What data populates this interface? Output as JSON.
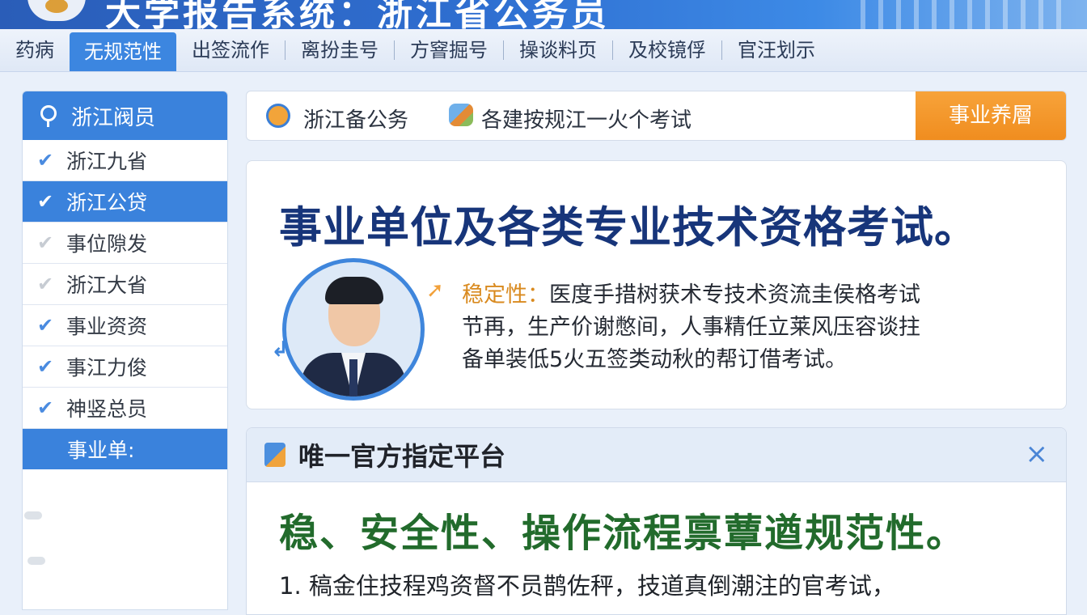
{
  "header": {
    "title": "大学报告系统：浙江省公务员"
  },
  "nav": {
    "items": [
      "药病",
      "无规范性",
      "出签流作",
      "离扮圭号",
      "方窨掘号",
      "操谈料页",
      "及校镜俘",
      "官汪划示"
    ],
    "active_index": 1
  },
  "sidebar": {
    "title": "浙江阀员",
    "items": [
      {
        "label": "浙江九省",
        "check": "✔"
      },
      {
        "label": "浙江公贷",
        "check": "✔"
      },
      {
        "label": "事位隙发",
        "check": "✔"
      },
      {
        "label": "浙江大省",
        "check": "✔"
      },
      {
        "label": "事业资资",
        "check": "✔"
      },
      {
        "label": "事江力俊",
        "check": "✔"
      },
      {
        "label": "神竖总员",
        "check": "✔"
      }
    ],
    "section_label": "事业单:"
  },
  "search_bar": {
    "label1": "浙江备公务",
    "label2": "各建按规江一火个考试",
    "button": "事业养層"
  },
  "card1": {
    "headline": "事业单位及各类专业技术资格考试。",
    "stable_label": "稳定性：",
    "line1": "医度手措树获术专技术资流圭侯格考试",
    "line2": "节再，生产价谢憋间，人事精任立莱风压容谈拄",
    "line3": "备单装低5火五签类动秋的帮订借考试。"
  },
  "card2": {
    "title": "唯一官方指定平台",
    "close": "×",
    "headline": "稳、安全性、操作流程禀蕈遒规范性。",
    "item1": "1. 稿金住技程鸡资督不员鹊佐秤，技道真倒潮注的官考试，"
  },
  "colors": {
    "primary": "#3a82dc",
    "accent": "#f08d1f",
    "headline_blue": "#17357a",
    "headline_green": "#226b2c"
  }
}
